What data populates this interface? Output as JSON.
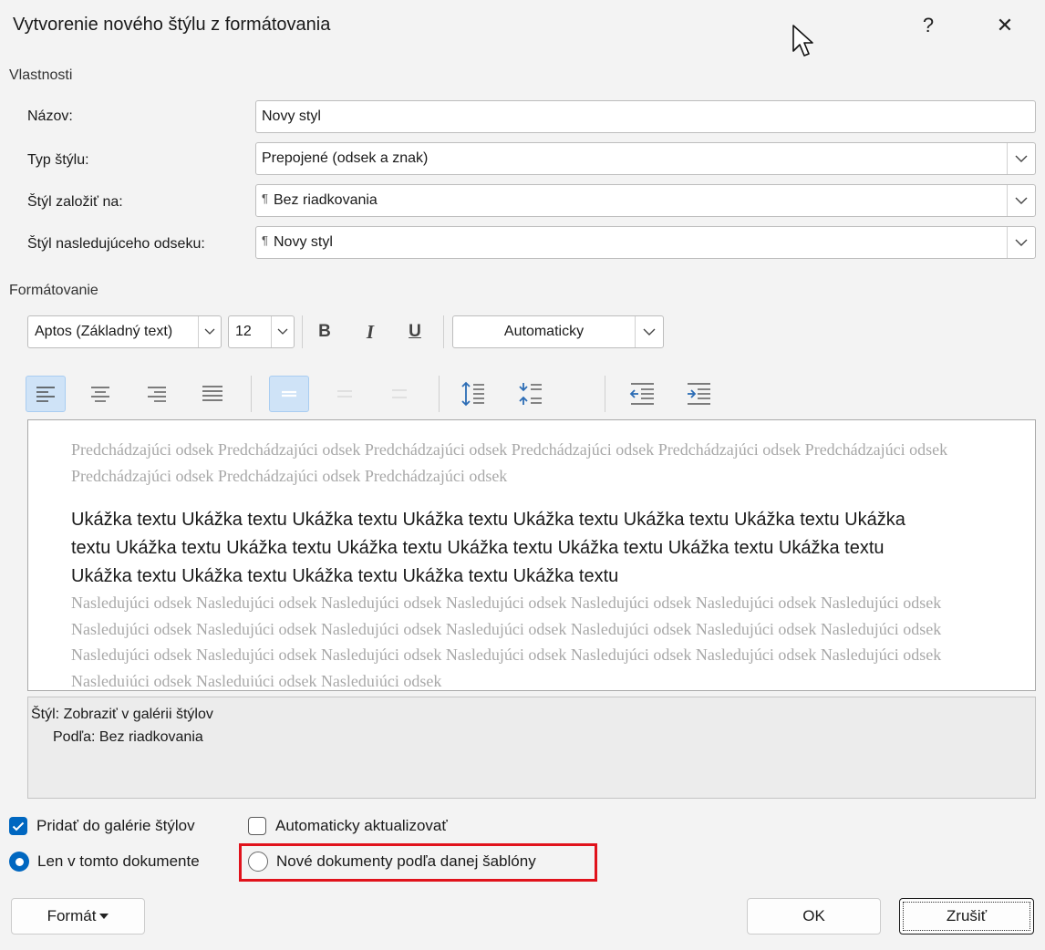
{
  "window": {
    "title": "Vytvorenie nového štýlu z formátovania",
    "help_label": "?",
    "close_label": "✕"
  },
  "properties": {
    "section_label": "Vlastnosti",
    "name_label": "Názov:",
    "name_value": "Novy styl",
    "style_type_label": "Typ štýlu:",
    "style_type_value": "Prepojené (odsek a znak)",
    "based_on_label": "Štýl založiť na:",
    "based_on_value": "Bez riadkovania",
    "next_style_label": "Štýl nasledujúceho odseku:",
    "next_style_value": "Novy styl"
  },
  "formatting": {
    "section_label": "Formátovanie",
    "font_value": "Aptos (Základný text)",
    "size_value": "12",
    "bold_label": "B",
    "italic_label": "I",
    "underline_label": "U",
    "color_value": "Automaticky"
  },
  "preview": {
    "previous_text": "Predchádzajúci odsek Predchádzajúci odsek Predchádzajúci odsek Predchádzajúci odsek Predchádzajúci odsek Predchádzajúci odsek Predchádzajúci odsek Predchádzajúci odsek Predchádzajúci odsek",
    "sample_text": "Ukážka textu Ukážka textu Ukážka textu Ukážka textu Ukážka textu Ukážka textu Ukážka textu Ukážka textu Ukážka textu Ukážka textu Ukážka textu Ukážka textu Ukážka textu Ukážka textu Ukážka textu Ukážka textu Ukážka textu Ukážka textu Ukážka textu Ukážka textu",
    "following_text": "Nasledujúci odsek Nasledujúci odsek Nasledujúci odsek Nasledujúci odsek Nasledujúci odsek Nasledujúci odsek Nasledujúci odsek Nasledujúci odsek Nasledujúci odsek Nasledujúci odsek Nasledujúci odsek Nasledujúci odsek Nasledujúci odsek Nasledujúci odsek Nasledujúci odsek Nasledujúci odsek Nasledujúci odsek Nasledujúci odsek Nasledujúci odsek Nasledujúci odsek Nasledujúci odsek Nasledujúci odsek Nasledujúci odsek Nasledujúci odsek"
  },
  "description": {
    "line1": "Štýl: Zobraziť v galérii štýlov",
    "line2": "Podľa: Bez riadkovania"
  },
  "options": {
    "add_to_gallery_label": "Pridať do galérie štýlov",
    "add_to_gallery_checked": true,
    "auto_update_label": "Automaticky aktualizovať",
    "auto_update_checked": false,
    "only_this_doc_label": "Len v tomto dokumente",
    "new_docs_label": "Nové dokumenty podľa danej šablóny"
  },
  "buttons": {
    "format_label": "Formát",
    "ok_label": "OK",
    "cancel_label": "Zrušiť"
  },
  "colors": {
    "accent": "#0067c0",
    "highlight": "#e0121b"
  }
}
